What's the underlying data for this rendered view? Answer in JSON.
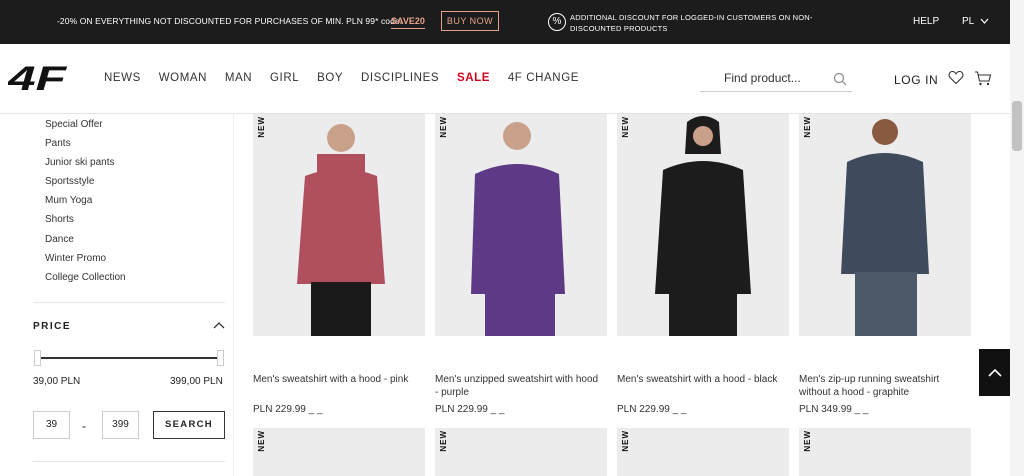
{
  "topbar": {
    "promo_text": "-20% ON EVERYTHING NOT DISCOUNTED FOR PURCHASES OF MIN. PLN 99* code:",
    "promo_code": "SAVE20",
    "buy_now": "BUY NOW",
    "percent_symbol": "%",
    "discount_info": "ADDITIONAL DISCOUNT FOR LOGGED-IN CUSTOMERS ON NON-DISCOUNTED PRODUCTS",
    "help": "HELP",
    "language": "PL",
    "accent_color": "#e8a28a"
  },
  "header": {
    "logo_text": "4F",
    "nav": [
      "NEWS",
      "WOMAN",
      "MAN",
      "GIRL",
      "BOY",
      "DISCIPLINES",
      "SALE",
      "4F CHANGE"
    ],
    "search_placeholder": "Find product...",
    "login": "LOG IN",
    "sale_color": "#d0021b"
  },
  "sidebar": {
    "categories": [
      "Special Offer",
      "Pants",
      "Junior ski pants",
      "Sportsstyle",
      "Mum Yoga",
      "Shorts",
      "Dance",
      "Winter Promo",
      "College Collection"
    ],
    "price": {
      "title": "PRICE",
      "min_label": "39,00 PLN",
      "max_label": "399,00 PLN",
      "min_value": "39",
      "separator": "-",
      "max_value": "399",
      "search_button": "SEARCH"
    }
  },
  "products": [
    {
      "badge": "NEW",
      "name": "Men's sweatshirt with a hood - pink",
      "price": "PLN 229.99 _ _",
      "color": "#b0505f"
    },
    {
      "badge": "NEW",
      "name": "Men's unzipped sweatshirt with hood - purple",
      "price": "PLN 229.99 _ _",
      "color": "#5e3a86"
    },
    {
      "badge": "NEW",
      "name": "Men's sweatshirt with a hood - black",
      "price": "PLN 229.99 _ _",
      "color": "#1c1c1c"
    },
    {
      "badge": "NEW",
      "name": "Men's zip-up running sweatshirt without a hood - graphite",
      "price": "PLN 349.99 _ _",
      "color": "#3f4a5c"
    }
  ],
  "products_row2": [
    {
      "badge": "NEW"
    },
    {
      "badge": "NEW"
    },
    {
      "badge": "NEW"
    },
    {
      "badge": "NEW"
    }
  ]
}
